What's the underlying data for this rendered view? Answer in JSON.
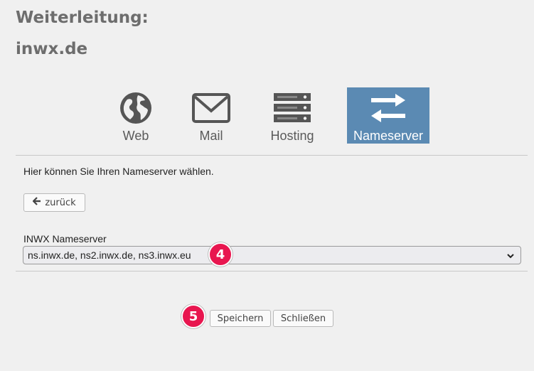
{
  "dialog": {
    "title": "Weiterleitung:",
    "domain": "inwx.de"
  },
  "tabs": [
    {
      "label": "Web",
      "icon": "globe-icon",
      "active": false
    },
    {
      "label": "Mail",
      "icon": "envelope-icon",
      "active": false
    },
    {
      "label": "Hosting",
      "icon": "server-icon",
      "active": false
    },
    {
      "label": "Nameserver",
      "icon": "exchange-arrows-icon",
      "active": true
    }
  ],
  "info_text": "Hier können Sie Ihren Nameserver wählen.",
  "back_button": {
    "label": "zurück",
    "icon": "arrow-left-icon"
  },
  "nameserver": {
    "label": "INWX Nameserver",
    "selected": "ns.inwx.de, ns2.inwx.de, ns3.inwx.eu"
  },
  "step_badges": [
    "4",
    "5"
  ],
  "footer": {
    "save_label": "Speichern",
    "close_label": "Schließen"
  },
  "colors": {
    "active_tab": "#5b8ab3",
    "badge": "#e8164f",
    "heading": "#6d6d6d"
  }
}
